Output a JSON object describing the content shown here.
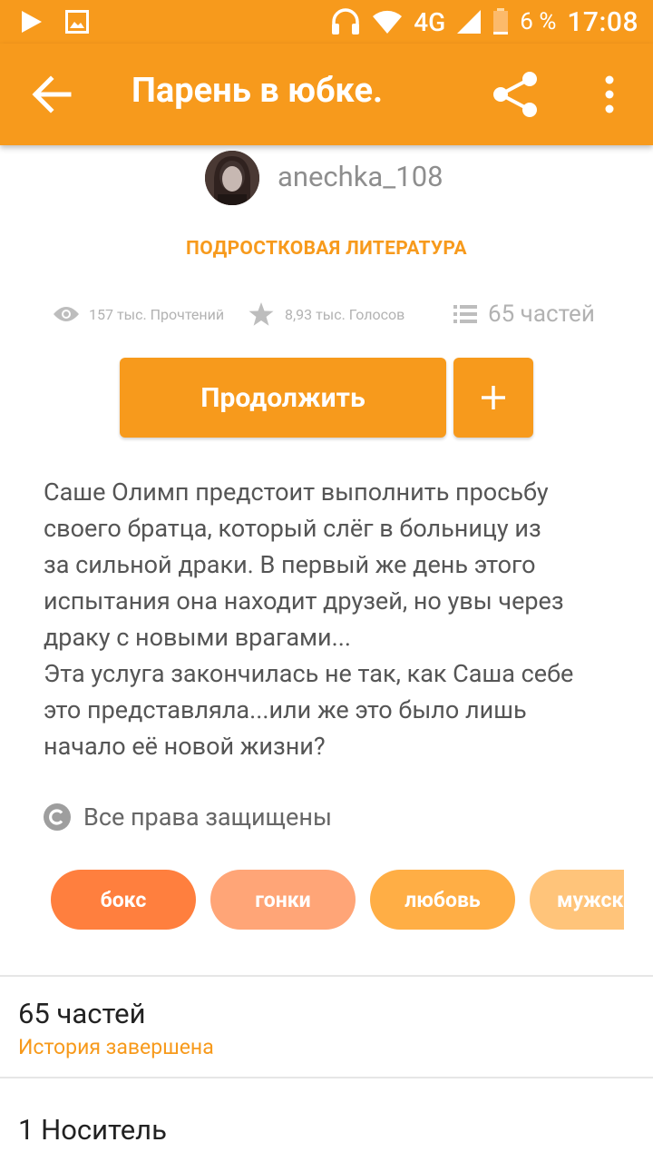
{
  "status_bar": {
    "network": "4G",
    "battery": "6 %",
    "time": "17:08",
    "icons": [
      "play-icon",
      "image-icon",
      "headset-icon",
      "wifi-icon",
      "signal-icon",
      "battery-icon"
    ]
  },
  "toolbar": {
    "title": "Парень в юбке.",
    "icons": [
      "back-arrow-icon",
      "share-icon",
      "more-vert-icon"
    ]
  },
  "author": {
    "name": "anechka_108"
  },
  "category": "ПОДРОСТКОВАЯ ЛИТЕРАТУРА",
  "stats": {
    "reads": "157 тыс. Прочтений",
    "votes": "8,93 тыс. Голосов",
    "parts": "65 частей",
    "icons": [
      "eye-icon",
      "star-icon",
      "list-icon"
    ]
  },
  "actions": {
    "continue_label": "Продолжить",
    "add_icon": "plus-icon"
  },
  "description": [
    "Саше Олимп предстоит выполнить просьбу",
    "своего братца, который слёг в больницу из",
    "за сильной драки. В первый же день этого",
    "испытания она находит друзей, но увы через",
    "драку с новыми врагами...",
    "Эта услуга закончилась не так, как Саша себе",
    "это представляла...или же это было лишь",
    "начало её новой жизни?"
  ],
  "rights": {
    "icon": "copyright-icon",
    "text": "Все права защищены"
  },
  "tags": [
    {
      "label": "бокс",
      "color": "#ff7f3e"
    },
    {
      "label": "гонки",
      "color": "#ffa577"
    },
    {
      "label": "любовь",
      "color": "#ffae45"
    },
    {
      "label": "мужск",
      "color": "#ffc47a"
    }
  ],
  "parts_section": {
    "title": "65 частей",
    "status": "История завершена"
  },
  "media_section": {
    "title": "1 Носитель"
  },
  "colors": {
    "accent": "#f79a1c",
    "text_dark": "#222222",
    "text_muted": "#b2b2b2"
  }
}
